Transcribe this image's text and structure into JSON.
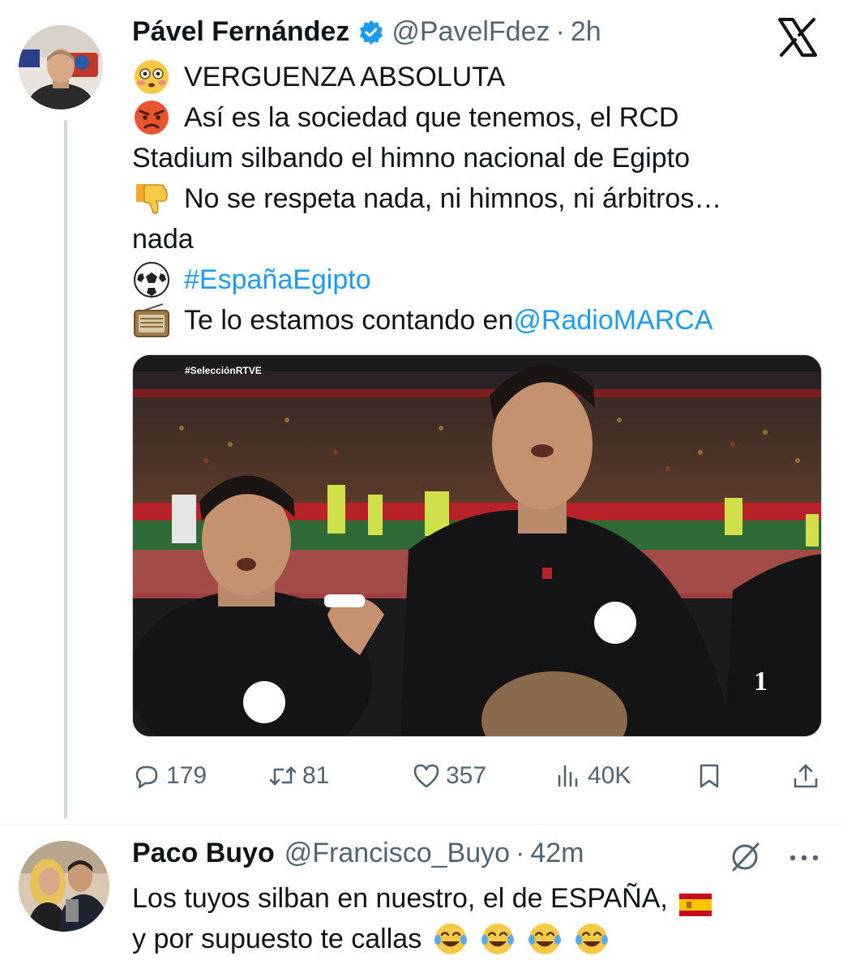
{
  "tweet": {
    "author_name": "Pável Fernández",
    "handle": "@PavelFdez",
    "separator": "·",
    "time": "2h",
    "lines": [
      {
        "emoji": "flushed-face-emoji",
        "parts": [
          {
            "text": "VERGUENZA ABSOLUTA"
          }
        ]
      },
      {
        "emoji": "angry-face-emoji",
        "parts": [
          {
            "text": "Así es la sociedad que tenemos, el RCD"
          }
        ]
      },
      {
        "emoji": null,
        "parts": [
          {
            "text": "Stadium silbando el himno nacional de Egipto"
          }
        ]
      },
      {
        "emoji": "thumbs-down-emoji",
        "parts": [
          {
            "text": "No se respeta nada, ni himnos, ni árbitros…"
          }
        ]
      },
      {
        "emoji": null,
        "parts": [
          {
            "text": "nada"
          }
        ]
      },
      {
        "emoji": "soccer-ball-emoji",
        "parts": [
          {
            "text": "#EspañaEgipto",
            "link": true
          }
        ]
      },
      {
        "emoji": "radio-emoji",
        "parts": [
          {
            "text": "Te lo estamos contando en "
          },
          {
            "text": "@RadioMARCA",
            "link": true
          }
        ]
      }
    ],
    "media": {
      "tag": "#SelecciónRTVE",
      "badge": "1"
    },
    "actions": {
      "replies": "179",
      "retweets": "81",
      "likes": "357",
      "views": "40K"
    }
  },
  "reply": {
    "author_name": "Paco Buyo",
    "handle": "@Francisco_Buyo",
    "separator": "·",
    "time": "42m",
    "line1": "Los tuyos silban en nuestro, el de ESPAÑA,",
    "line2": "y por supuesto te callas"
  },
  "colors": {
    "link": "#1d9bf0",
    "secondary_text": "#536471",
    "verified": "#1d9bf0",
    "text": "#0f1419"
  }
}
